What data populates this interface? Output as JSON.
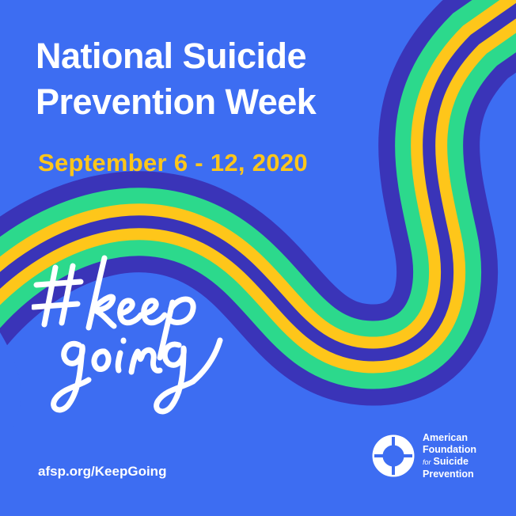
{
  "title_line1": "National Suicide",
  "title_line2": "Prevention Week",
  "date": "September 6 - 12, 2020",
  "hashtag": "#KeepGoing",
  "url": "afsp.org/KeepGoing",
  "org": {
    "line1": "American",
    "line2": "Foundation",
    "for": "for",
    "line3": "Suicide",
    "line4": "Prevention"
  },
  "colors": {
    "background": "#3d6df2",
    "navy": "#3a34b8",
    "green": "#2cd98c",
    "yellow": "#fec61a",
    "white": "#ffffff"
  }
}
